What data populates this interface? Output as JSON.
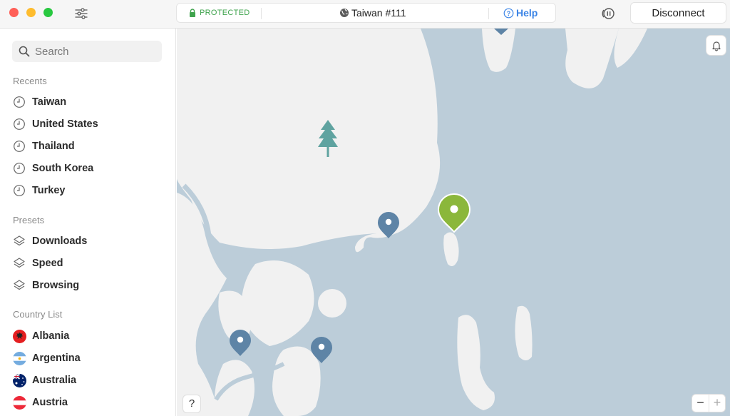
{
  "window": {
    "status": "PROTECTED",
    "server": "Taiwan #111",
    "help": "Help",
    "disconnect": "Disconnect"
  },
  "search": {
    "placeholder": "Search"
  },
  "recents": {
    "heading": "Recents",
    "items": [
      "Taiwan",
      "United States",
      "Thailand",
      "South Korea",
      "Turkey"
    ]
  },
  "presets": {
    "heading": "Presets",
    "items": [
      "Downloads",
      "Speed",
      "Browsing"
    ]
  },
  "countries": {
    "heading": "Country List",
    "items": [
      "Albania",
      "Argentina",
      "Australia",
      "Austria"
    ]
  },
  "map": {
    "help": "?",
    "zoom_out": "−",
    "zoom_in": "+"
  },
  "colors": {
    "protected": "#3fa34d",
    "accent": "#3b84e6",
    "connected_pin": "#8bb73b",
    "server_pin": "#5e84a6",
    "water": "#bccdd9",
    "land": "#f1f1f1"
  }
}
